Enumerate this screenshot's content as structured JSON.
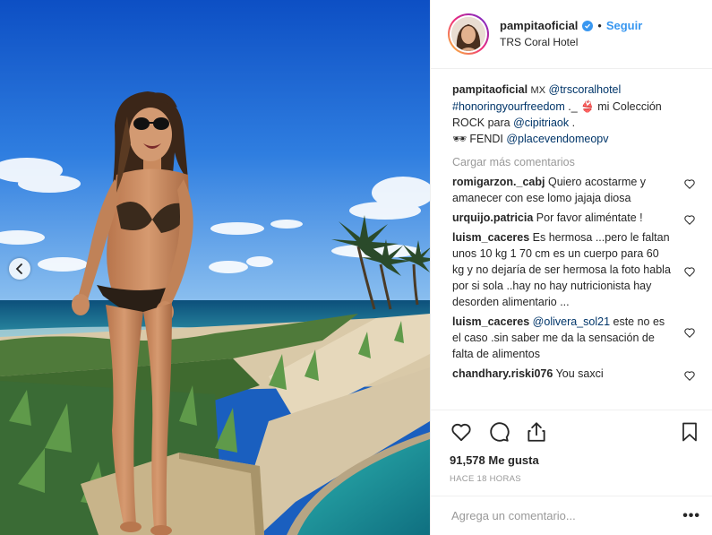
{
  "header": {
    "username": "pampitaoficial",
    "separator": "•",
    "follow_label": "Seguir",
    "location": "TRS Coral Hotel"
  },
  "caption": {
    "username": "pampitaoficial",
    "country": "MX",
    "mention_hotel": "@trscoralhotel",
    "hashtag": "#honoringyourfreedom",
    "text_after_hashtag": " ._ ",
    "bikini_emoji": "👙",
    "text_collection": " mi Colección ROCK para ",
    "mention_brand": "@cipitriaok",
    "text_end": " .",
    "sunglasses_emoji": "🕶",
    "fendi_text": " FENDI ",
    "mention_store": "@placevendomeopv"
  },
  "load_more_label": "Cargar más comentarios",
  "comments": [
    {
      "user": "romigarzon._cabj",
      "text": "Quiero acostarme y amanecer con ese lomo jajaja diosa"
    },
    {
      "user": "urquijo.patricia",
      "text": "Por favor aliméntate !"
    },
    {
      "user": "luism_caceres",
      "text": "Es hermosa ...pero le faltan unos 10 kg 1 70 cm es un cuerpo para 60 kg y no dejaría de ser hermosa la foto habla por si sola ..hay no hay nutricionista hay desorden alimentario ..."
    },
    {
      "user": "luism_caceres",
      "mention": "@olivera_sol21",
      "text": " este no es el caso .sin saber me da la sensación de falta de alimentos"
    },
    {
      "user": "chandhary.riski076",
      "text": "You saxci"
    }
  ],
  "likes": "91,578 Me gusta",
  "timestamp": "HACE 18 HORAS",
  "add_comment_placeholder": "Agrega un comentario...",
  "more_label": "•••",
  "icons": [
    "heart-icon",
    "comment-icon",
    "share-icon",
    "bookmark-icon",
    "verified-badge-icon",
    "chevron-left-icon"
  ],
  "colors": {
    "link": "#003569",
    "follow": "#3897f0",
    "muted": "#999999",
    "text": "#262626"
  }
}
